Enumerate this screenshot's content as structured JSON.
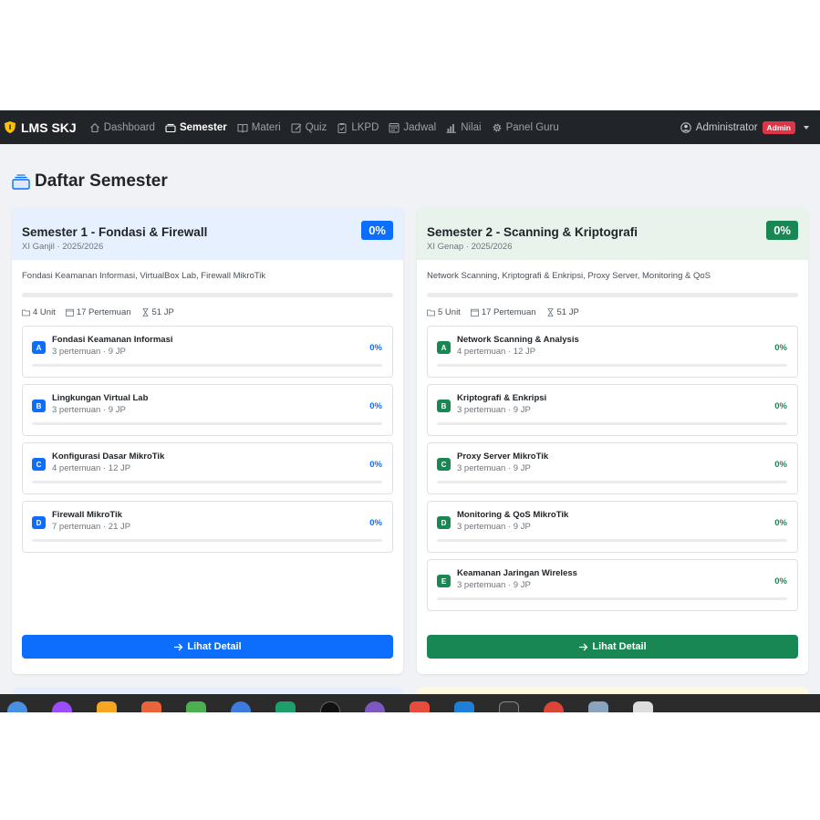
{
  "navbar": {
    "brand": "LMS SKJ",
    "items": [
      {
        "label": "Dashboard",
        "icon": "house-icon",
        "active": false
      },
      {
        "label": "Semester",
        "icon": "stack-icon",
        "active": true
      },
      {
        "label": "Materi",
        "icon": "book-icon",
        "active": false
      },
      {
        "label": "Quiz",
        "icon": "pencil-square-icon",
        "active": false
      },
      {
        "label": "LKPD",
        "icon": "clipboard-icon",
        "active": false
      },
      {
        "label": "Jadwal",
        "icon": "calendar-grid-icon",
        "active": false
      },
      {
        "label": "Nilai",
        "icon": "bar-chart-icon",
        "active": false
      },
      {
        "label": "Panel Guru",
        "icon": "gear-icon",
        "active": false
      }
    ],
    "user": "Administrator",
    "role_badge": "Admin"
  },
  "page": {
    "title": "Daftar Semester"
  },
  "semesters": [
    {
      "title": "Semester 1 - Fondasi & Firewall",
      "subtitle": "XI Ganjil · 2025/2026",
      "percent": "0%",
      "progress": 0,
      "description": "Fondasi Keamanan Informasi, VirtualBox Lab, Firewall MikroTik",
      "meta": {
        "units": "4 Unit",
        "meetings": "17 Pertemuan",
        "hours": "51 JP"
      },
      "accent": "#0d6efd",
      "units": [
        {
          "letter": "A",
          "name": "Fondasi Keamanan Informasi",
          "info": "3 pertemuan · 9 JP",
          "percent": "0%"
        },
        {
          "letter": "B",
          "name": "Lingkungan Virtual Lab",
          "info": "3 pertemuan · 9 JP",
          "percent": "0%"
        },
        {
          "letter": "C",
          "name": "Konfigurasi Dasar MikroTik",
          "info": "4 pertemuan · 12 JP",
          "percent": "0%"
        },
        {
          "letter": "D",
          "name": "Firewall MikroTik",
          "info": "7 pertemuan · 21 JP",
          "percent": "0%"
        }
      ],
      "button": "Lihat Detail"
    },
    {
      "title": "Semester 2 - Scanning & Kriptografi",
      "subtitle": "XI Genap · 2025/2026",
      "percent": "0%",
      "progress": 0,
      "description": "Network Scanning, Kriptografi & Enkripsi, Proxy Server, Monitoring & QoS",
      "meta": {
        "units": "5 Unit",
        "meetings": "17 Pertemuan",
        "hours": "51 JP"
      },
      "accent": "#198754",
      "units": [
        {
          "letter": "A",
          "name": "Network Scanning & Analysis",
          "info": "4 pertemuan · 12 JP",
          "percent": "0%"
        },
        {
          "letter": "B",
          "name": "Kriptografi & Enkripsi",
          "info": "3 pertemuan · 9 JP",
          "percent": "0%"
        },
        {
          "letter": "C",
          "name": "Proxy Server MikroTik",
          "info": "3 pertemuan · 9 JP",
          "percent": "0%"
        },
        {
          "letter": "D",
          "name": "Monitoring & QoS MikroTik",
          "info": "3 pertemuan · 9 JP",
          "percent": "0%"
        },
        {
          "letter": "E",
          "name": "Keamanan Jaringan Wireless",
          "info": "3 pertemuan · 9 JP",
          "percent": "0%"
        }
      ],
      "button": "Lihat Detail"
    }
  ],
  "taskbar": {
    "apps": [
      {
        "icon": "finder-icon",
        "color": "#4a90e2"
      },
      {
        "icon": "podcast-icon",
        "color": "#9b4dff"
      },
      {
        "icon": "photos-icon",
        "color": "#f5a623"
      },
      {
        "icon": "orange-app-icon",
        "color": "#e8643a"
      },
      {
        "icon": "hex-app-icon",
        "color": "#4caf50"
      },
      {
        "icon": "shortcuts-icon",
        "color": "#3d7be0"
      },
      {
        "icon": "vscode-green-icon",
        "color": "#1e9e6a"
      },
      {
        "icon": "chatgpt-icon",
        "color": "#111111"
      },
      {
        "icon": "purple-app-icon",
        "color": "#7e57c2"
      },
      {
        "icon": "color-app-icon",
        "color": "#e74c3c"
      },
      {
        "icon": "vscode-icon",
        "color": "#1f7fd6"
      },
      {
        "icon": "terminal-icon",
        "color": "#333333"
      },
      {
        "icon": "chrome-icon",
        "color": "#db4437"
      },
      {
        "icon": "preview-icon",
        "color": "#8aa4bf"
      },
      {
        "icon": "textedit-icon",
        "color": "#dddddd"
      }
    ]
  }
}
